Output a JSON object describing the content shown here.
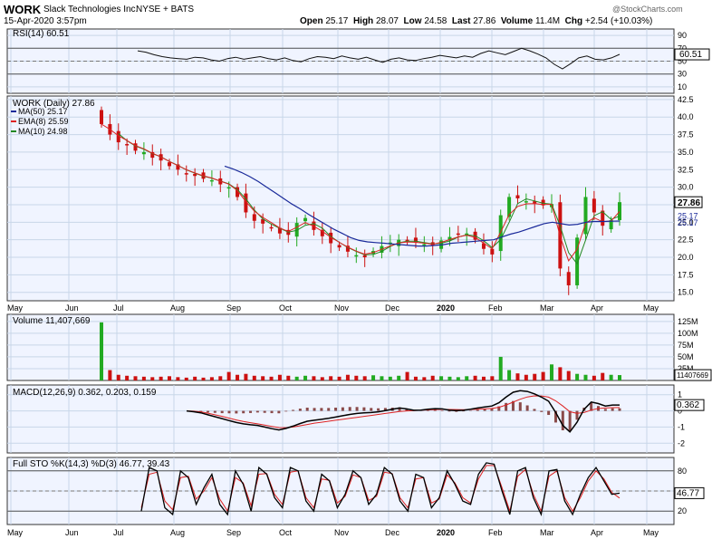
{
  "header": {
    "ticker": "WORK",
    "company": "Slack Technologies Inc.",
    "exchange": "NYSE + BATS",
    "datetime": "15-Apr-2020 3:57pm",
    "open_label": "Open",
    "open": "25.17",
    "high_label": "High",
    "high": "28.07",
    "low_label": "Low",
    "low": "24.58",
    "last_label": "Last",
    "last": "27.86",
    "volume_label": "Volume",
    "volume": "11.4M",
    "chg_label": "Chg",
    "chg": "+2.54 (+10.03%)",
    "watermark": "@StockCharts.com"
  },
  "colors": {
    "up": "#22aa22",
    "down": "#cc1111",
    "ma50": "#1a2a9a",
    "ema8": "#dd2222",
    "ma10": "#228822",
    "grid": "#c8d6e8",
    "panel_bg": "#f0f4ff"
  },
  "chart_data": [
    {
      "type": "line",
      "panel": "rsi",
      "title": "RSI(14) 60.51",
      "series": [
        {
          "name": "RSI(14)",
          "last_label": "60.51",
          "values": [
            66,
            64,
            60,
            57,
            55,
            54,
            53,
            56,
            55,
            52,
            50,
            54,
            56,
            53,
            55,
            57,
            54,
            52,
            55,
            51,
            49,
            54,
            57,
            56,
            54,
            58,
            55,
            53,
            56,
            52,
            48,
            53,
            55,
            52,
            51,
            54,
            56,
            59,
            57,
            55,
            58,
            56,
            62,
            66,
            63,
            60,
            65,
            70,
            66,
            61,
            55,
            45,
            38,
            46,
            55,
            58,
            53,
            52,
            55,
            60.5
          ]
        }
      ],
      "y_ticks": [
        "90",
        "70",
        "50",
        "30",
        "10"
      ],
      "ylim": [
        0,
        100
      ]
    },
    {
      "type": "candlestick",
      "panel": "price",
      "title": "WORK (Daily) 27.86",
      "x_ticks": [
        "May",
        "Jun",
        "Jul",
        "Aug",
        "Sep",
        "Oct",
        "Nov",
        "Dec",
        "2020",
        "Feb",
        "Mar",
        "Apr",
        "May"
      ],
      "y_ticks": [
        "42.5",
        "40.0",
        "37.5",
        "35.0",
        "32.5",
        "30.0",
        "27.5",
        "25.0",
        "22.5",
        "20.0",
        "17.5",
        "15.0"
      ],
      "ylim": [
        13.8,
        43.0
      ],
      "price_labels": {
        "last": "27.86",
        "ma50": "25.17",
        "ema_ma10": "25.17"
      },
      "legend": [
        {
          "label": "MA(50) 25.17",
          "color": "#1a2a9a"
        },
        {
          "label": "EMA(8) 25.59",
          "color": "#dd2222"
        },
        {
          "label": "MA(10) 24.98",
          "color": "#228822"
        }
      ],
      "close": [
        39.0,
        37.5,
        36.4,
        36.0,
        35.2,
        35.0,
        34.2,
        33.8,
        33.0,
        32.5,
        31.9,
        31.6,
        31.2,
        31.0,
        30.4,
        30.0,
        28.6,
        26.4,
        25.2,
        24.8,
        24.2,
        23.4,
        23.2,
        24.9,
        25.6,
        23.9,
        23.0,
        22.0,
        21.4,
        20.8,
        20.3,
        20.0,
        20.9,
        21.6,
        22.1,
        22.5,
        22.3,
        22.1,
        21.9,
        21.7,
        22.4,
        22.9,
        23.3,
        23.4,
        22.5,
        21.2,
        20.4,
        26.0,
        28.6,
        28.4,
        28.0,
        27.7,
        27.4,
        27.6,
        18.4,
        16.0,
        22.8,
        28.6,
        26.4,
        24.5,
        25.3,
        27.86
      ],
      "ma50": [
        null,
        null,
        null,
        null,
        null,
        null,
        null,
        null,
        null,
        null,
        null,
        null,
        null,
        null,
        33.0,
        32.6,
        32.1,
        31.5,
        30.8,
        30.0,
        29.2,
        28.4,
        27.6,
        26.9,
        26.1,
        25.4,
        24.7,
        24.0,
        23.4,
        22.8,
        22.4,
        22.2,
        22.1,
        22.0,
        21.9,
        21.8,
        21.7,
        21.6,
        21.6,
        21.7,
        21.8,
        22.0,
        22.1,
        22.2,
        22.3,
        22.4,
        22.5,
        22.9,
        23.3,
        23.6,
        24.0,
        24.4,
        24.8,
        25.0,
        24.8,
        24.6,
        24.7,
        25.0,
        25.1,
        25.1,
        25.15,
        25.17
      ]
    },
    {
      "type": "bar",
      "panel": "volume",
      "title": "Volume 11,407,669",
      "y_ticks": [
        "125M",
        "100M",
        "75M",
        "50M",
        "25M"
      ],
      "ylim": [
        0,
        140
      ],
      "value_label": "11407669",
      "values_m": [
        123,
        22,
        12,
        10,
        9,
        8,
        7,
        8,
        9,
        7,
        6,
        8,
        6,
        7,
        9,
        18,
        12,
        14,
        10,
        9,
        8,
        12,
        10,
        8,
        10,
        9,
        7,
        9,
        8,
        12,
        10,
        9,
        11,
        9,
        8,
        10,
        18,
        8,
        7,
        10,
        9,
        8,
        7,
        9,
        10,
        8,
        9,
        50,
        22,
        15,
        12,
        14,
        18,
        34,
        28,
        20,
        14,
        12,
        10,
        16,
        12,
        11.4
      ]
    },
    {
      "type": "line",
      "panel": "macd",
      "title": "MACD(12,26,9) 0.362, 0.203, 0.159",
      "series": [
        {
          "name": "MACD",
          "values": [
            0.0,
            -0.05,
            -0.12,
            -0.24,
            -0.36,
            -0.48,
            -0.6,
            -0.72,
            -0.8,
            -0.86,
            -0.9,
            -1.0,
            -1.1,
            -1.18,
            -1.08,
            -0.94,
            -0.78,
            -0.64,
            -0.58,
            -0.52,
            -0.46,
            -0.38,
            -0.3,
            -0.22,
            -0.16,
            -0.12,
            -0.1,
            -0.06,
            0.02,
            0.1,
            0.18,
            0.12,
            0.04,
            0.05,
            0.1,
            0.14,
            0.12,
            0.05,
            0.02,
            0.04,
            0.1,
            0.18,
            0.24,
            0.3,
            0.5,
            0.85,
            1.15,
            1.25,
            1.2,
            1.05,
            0.85,
            0.6,
            -0.1,
            -0.9,
            -1.3,
            -0.7,
            0.1,
            0.55,
            0.45,
            0.3,
            0.36,
            0.362
          ]
        },
        {
          "name": "Signal",
          "values": [
            0.0,
            -0.02,
            -0.06,
            -0.14,
            -0.24,
            -0.34,
            -0.45,
            -0.56,
            -0.65,
            -0.73,
            -0.8,
            -0.88,
            -0.96,
            -1.03,
            -1.04,
            -1.0,
            -0.92,
            -0.84,
            -0.76,
            -0.7,
            -0.64,
            -0.58,
            -0.52,
            -0.46,
            -0.4,
            -0.34,
            -0.28,
            -0.22,
            -0.16,
            -0.1,
            -0.04,
            0.0,
            0.02,
            0.04,
            0.06,
            0.08,
            0.09,
            0.09,
            0.08,
            0.07,
            0.08,
            0.1,
            0.12,
            0.15,
            0.22,
            0.36,
            0.54,
            0.72,
            0.86,
            0.93,
            0.92,
            0.85,
            0.62,
            0.3,
            -0.05,
            -0.15,
            -0.1,
            0.05,
            0.15,
            0.18,
            0.2,
            0.203
          ]
        }
      ],
      "y_ticks": [
        "1",
        "0",
        "-1",
        "-2"
      ],
      "ylim": [
        -2.6,
        1.6
      ],
      "value_label": "0.362"
    },
    {
      "type": "line",
      "panel": "stochastic",
      "title": "Full STO %K(14,3) %D(3) 46.77, 39.43",
      "series": [
        {
          "name": "%K",
          "values": [
            20,
            85,
            80,
            25,
            15,
            80,
            70,
            30,
            55,
            75,
            30,
            15,
            80,
            60,
            20,
            85,
            75,
            40,
            25,
            85,
            80,
            35,
            20,
            75,
            65,
            25,
            45,
            80,
            70,
            30,
            45,
            85,
            75,
            35,
            20,
            75,
            70,
            25,
            40,
            80,
            60,
            35,
            30,
            75,
            92,
            90,
            50,
            15,
            80,
            85,
            40,
            15,
            80,
            82,
            35,
            15,
            45,
            70,
            85,
            65,
            45,
            46.77
          ]
        },
        {
          "name": "%D",
          "values": [
            25,
            75,
            78,
            35,
            22,
            70,
            72,
            38,
            50,
            70,
            38,
            20,
            70,
            62,
            28,
            75,
            76,
            45,
            30,
            78,
            80,
            40,
            25,
            68,
            66,
            32,
            42,
            74,
            70,
            36,
            42,
            78,
            76,
            40,
            25,
            68,
            70,
            32,
            38,
            74,
            62,
            40,
            32,
            68,
            88,
            88,
            55,
            20,
            72,
            82,
            45,
            20,
            72,
            80,
            40,
            20,
            40,
            65,
            80,
            68,
            48,
            39.43
          ]
        }
      ],
      "y_ticks": [
        "80",
        "50",
        "20"
      ],
      "ylim": [
        0,
        100
      ],
      "value_labels": {
        "k": "46.77",
        "d": "39.43"
      }
    }
  ]
}
